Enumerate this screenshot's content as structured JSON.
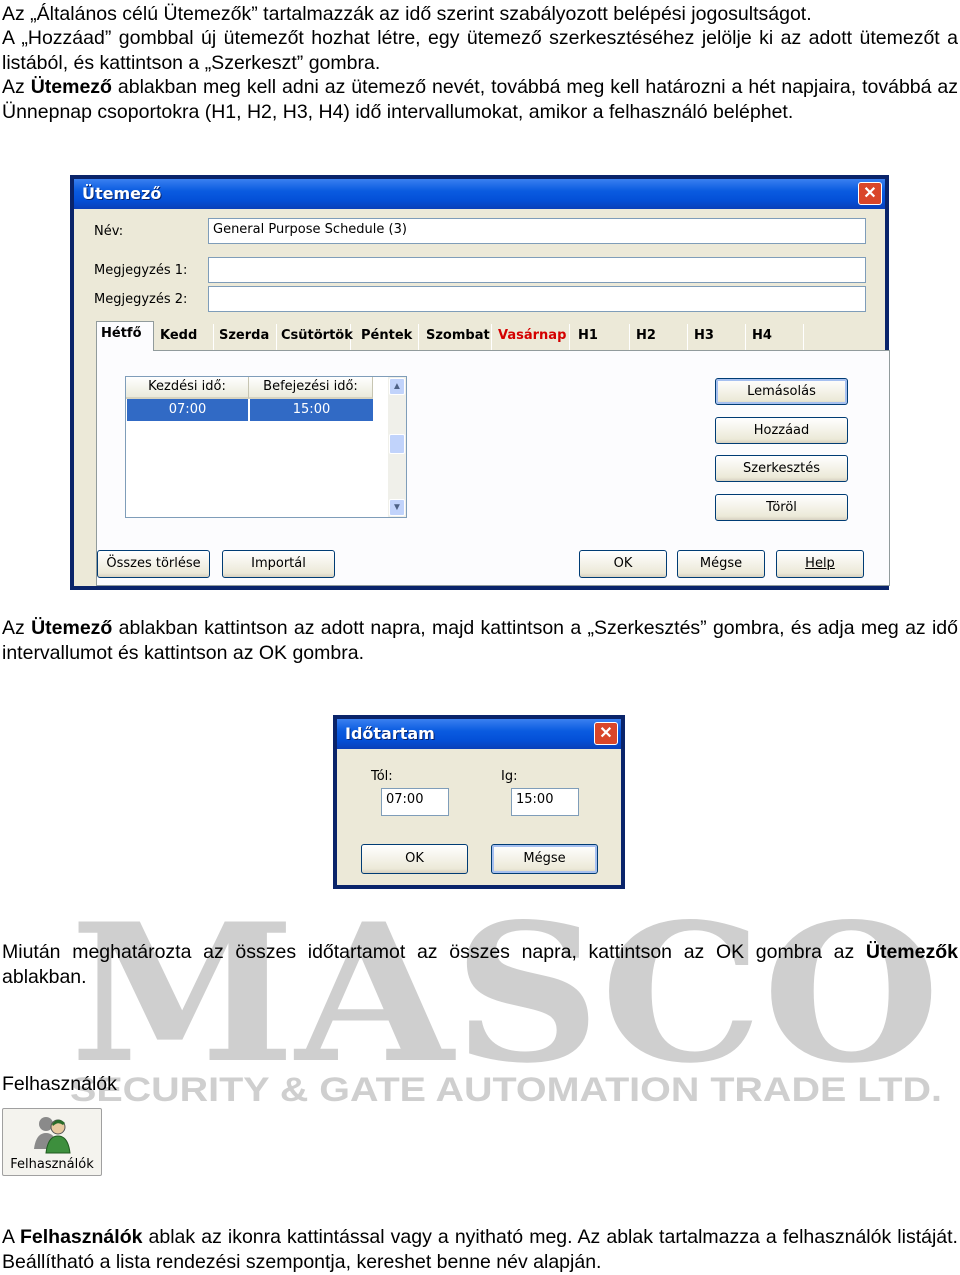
{
  "watermark": {
    "big": "MASCO",
    "line": "SECURITY & GATE AUTOMATION TRADE LTD.",
    "color": "#c8c8c8"
  },
  "p1": {
    "l1": "Az „Általános célú Ütemezők” tartalmazzák az idő szerint szabályozott belépési jogosultságot.",
    "l2": "A „Hozzáad” gombbal új ütemezőt hozhat létre, egy ütemező szerkesztéséhez jelölje ki az adott ütemezőt a listából, és kattintson a „Szerkeszt” gombra.",
    "l3_pre": "Az ",
    "l3_bold": "Ütemező",
    "l3_post": " ablakban meg kell adni az ütemező nevét, továbbá meg kell határozni a hét napjaira, továbbá az Ünnepnap csoportokra (H1, H2, H3, H4) idő intervallumokat, amikor a felhasználó beléphet."
  },
  "utemezo": {
    "title": "Ütemező",
    "close": "✕",
    "nev_label": "Név:",
    "nev_value": "General Purpose Schedule (3)",
    "megj1_label": "Megjegyzés 1:",
    "megj2_label": "Megjegyzés 2:",
    "tabs": [
      "Hétfő",
      "Kedd",
      "Szerda",
      "Csütörtök",
      "Péntek",
      "Szombat",
      "Vasárnap",
      "H1",
      "H2",
      "H3",
      "H4"
    ],
    "col1": "Kezdési idő:",
    "col2": "Befejezési idő:",
    "row_start": "07:00",
    "row_end": "15:00",
    "btn_lemasolas": "Lemásolás",
    "btn_hozzaad": "Hozzáad",
    "btn_szerkesztes": "Szerkesztés",
    "btn_torol": "Töröl",
    "btn_osszes": "Összes törlése",
    "btn_importal": "Importál",
    "btn_ok": "OK",
    "btn_megse": "Mégse",
    "btn_help": "Help",
    "sunday_color": "#d40000"
  },
  "p2": {
    "pre": "Az ",
    "bold": "Ütemező",
    "post": " ablakban kattintson az adott napra, majd kattintson a „Szerkesztés” gombra, és adja meg az idő intervallumot és kattintson az OK gombra."
  },
  "idotartam": {
    "title": "Időtartam",
    "tol_label": "Tól:",
    "ig_label": "Ig:",
    "tol_value": "07:00",
    "ig_value": "15:00",
    "ok": "OK",
    "megse": "Mégse"
  },
  "p3": {
    "pre": "Miután meghatározta az összes időtartamot az összes napra, kattintson az OK gombra az ",
    "bold": "Ütemezők",
    "post": " ablakban."
  },
  "felh_heading": "Felhasználók",
  "felh_icon_label": "Felhasználók",
  "p4": {
    "pre": "A ",
    "bold": "Felhasználók",
    "post": " ablak az ikonra kattintással vagy a nyitható meg. Az ablak tartalmazza a felhasználók listáját. Beállítható a lista rendezési szempontja, kereshet benne név alapján."
  }
}
